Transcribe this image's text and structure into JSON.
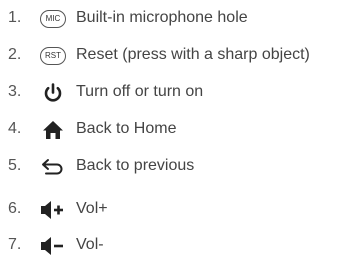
{
  "items": [
    {
      "number": "1.",
      "icon": "mic-icon",
      "icon_text": "MIC",
      "label": "Built-in microphone hole"
    },
    {
      "number": "2.",
      "icon": "reset-icon",
      "icon_text": "RST",
      "label": "Reset (press with a sharp object)"
    },
    {
      "number": "3.",
      "icon": "power-icon",
      "label": "Turn off or turn on"
    },
    {
      "number": "4.",
      "icon": "home-icon",
      "label": "Back to Home"
    },
    {
      "number": "5.",
      "icon": "back-arrow-icon",
      "label": "Back to previous"
    },
    {
      "number": "6.",
      "icon": "volume-up-icon",
      "label": "Vol+"
    },
    {
      "number": "7.",
      "icon": "volume-down-icon",
      "label": "Vol-"
    }
  ],
  "colors": {
    "text": "#444444",
    "icon": "#222222",
    "pill_border": "#555555"
  }
}
